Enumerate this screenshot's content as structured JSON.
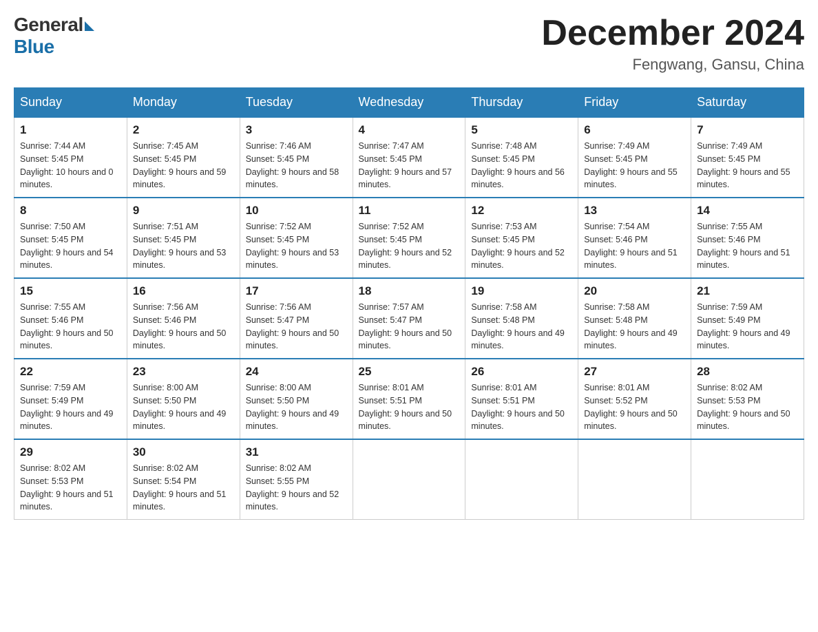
{
  "header": {
    "logo_general": "General",
    "logo_blue": "Blue",
    "month_title": "December 2024",
    "location": "Fengwang, Gansu, China"
  },
  "days_of_week": [
    "Sunday",
    "Monday",
    "Tuesday",
    "Wednesday",
    "Thursday",
    "Friday",
    "Saturday"
  ],
  "weeks": [
    [
      {
        "day": "1",
        "sunrise": "7:44 AM",
        "sunset": "5:45 PM",
        "daylight": "10 hours and 0 minutes."
      },
      {
        "day": "2",
        "sunrise": "7:45 AM",
        "sunset": "5:45 PM",
        "daylight": "9 hours and 59 minutes."
      },
      {
        "day": "3",
        "sunrise": "7:46 AM",
        "sunset": "5:45 PM",
        "daylight": "9 hours and 58 minutes."
      },
      {
        "day": "4",
        "sunrise": "7:47 AM",
        "sunset": "5:45 PM",
        "daylight": "9 hours and 57 minutes."
      },
      {
        "day": "5",
        "sunrise": "7:48 AM",
        "sunset": "5:45 PM",
        "daylight": "9 hours and 56 minutes."
      },
      {
        "day": "6",
        "sunrise": "7:49 AM",
        "sunset": "5:45 PM",
        "daylight": "9 hours and 55 minutes."
      },
      {
        "day": "7",
        "sunrise": "7:49 AM",
        "sunset": "5:45 PM",
        "daylight": "9 hours and 55 minutes."
      }
    ],
    [
      {
        "day": "8",
        "sunrise": "7:50 AM",
        "sunset": "5:45 PM",
        "daylight": "9 hours and 54 minutes."
      },
      {
        "day": "9",
        "sunrise": "7:51 AM",
        "sunset": "5:45 PM",
        "daylight": "9 hours and 53 minutes."
      },
      {
        "day": "10",
        "sunrise": "7:52 AM",
        "sunset": "5:45 PM",
        "daylight": "9 hours and 53 minutes."
      },
      {
        "day": "11",
        "sunrise": "7:52 AM",
        "sunset": "5:45 PM",
        "daylight": "9 hours and 52 minutes."
      },
      {
        "day": "12",
        "sunrise": "7:53 AM",
        "sunset": "5:45 PM",
        "daylight": "9 hours and 52 minutes."
      },
      {
        "day": "13",
        "sunrise": "7:54 AM",
        "sunset": "5:46 PM",
        "daylight": "9 hours and 51 minutes."
      },
      {
        "day": "14",
        "sunrise": "7:55 AM",
        "sunset": "5:46 PM",
        "daylight": "9 hours and 51 minutes."
      }
    ],
    [
      {
        "day": "15",
        "sunrise": "7:55 AM",
        "sunset": "5:46 PM",
        "daylight": "9 hours and 50 minutes."
      },
      {
        "day": "16",
        "sunrise": "7:56 AM",
        "sunset": "5:46 PM",
        "daylight": "9 hours and 50 minutes."
      },
      {
        "day": "17",
        "sunrise": "7:56 AM",
        "sunset": "5:47 PM",
        "daylight": "9 hours and 50 minutes."
      },
      {
        "day": "18",
        "sunrise": "7:57 AM",
        "sunset": "5:47 PM",
        "daylight": "9 hours and 50 minutes."
      },
      {
        "day": "19",
        "sunrise": "7:58 AM",
        "sunset": "5:48 PM",
        "daylight": "9 hours and 49 minutes."
      },
      {
        "day": "20",
        "sunrise": "7:58 AM",
        "sunset": "5:48 PM",
        "daylight": "9 hours and 49 minutes."
      },
      {
        "day": "21",
        "sunrise": "7:59 AM",
        "sunset": "5:49 PM",
        "daylight": "9 hours and 49 minutes."
      }
    ],
    [
      {
        "day": "22",
        "sunrise": "7:59 AM",
        "sunset": "5:49 PM",
        "daylight": "9 hours and 49 minutes."
      },
      {
        "day": "23",
        "sunrise": "8:00 AM",
        "sunset": "5:50 PM",
        "daylight": "9 hours and 49 minutes."
      },
      {
        "day": "24",
        "sunrise": "8:00 AM",
        "sunset": "5:50 PM",
        "daylight": "9 hours and 49 minutes."
      },
      {
        "day": "25",
        "sunrise": "8:01 AM",
        "sunset": "5:51 PM",
        "daylight": "9 hours and 50 minutes."
      },
      {
        "day": "26",
        "sunrise": "8:01 AM",
        "sunset": "5:51 PM",
        "daylight": "9 hours and 50 minutes."
      },
      {
        "day": "27",
        "sunrise": "8:01 AM",
        "sunset": "5:52 PM",
        "daylight": "9 hours and 50 minutes."
      },
      {
        "day": "28",
        "sunrise": "8:02 AM",
        "sunset": "5:53 PM",
        "daylight": "9 hours and 50 minutes."
      }
    ],
    [
      {
        "day": "29",
        "sunrise": "8:02 AM",
        "sunset": "5:53 PM",
        "daylight": "9 hours and 51 minutes."
      },
      {
        "day": "30",
        "sunrise": "8:02 AM",
        "sunset": "5:54 PM",
        "daylight": "9 hours and 51 minutes."
      },
      {
        "day": "31",
        "sunrise": "8:02 AM",
        "sunset": "5:55 PM",
        "daylight": "9 hours and 52 minutes."
      },
      null,
      null,
      null,
      null
    ]
  ]
}
